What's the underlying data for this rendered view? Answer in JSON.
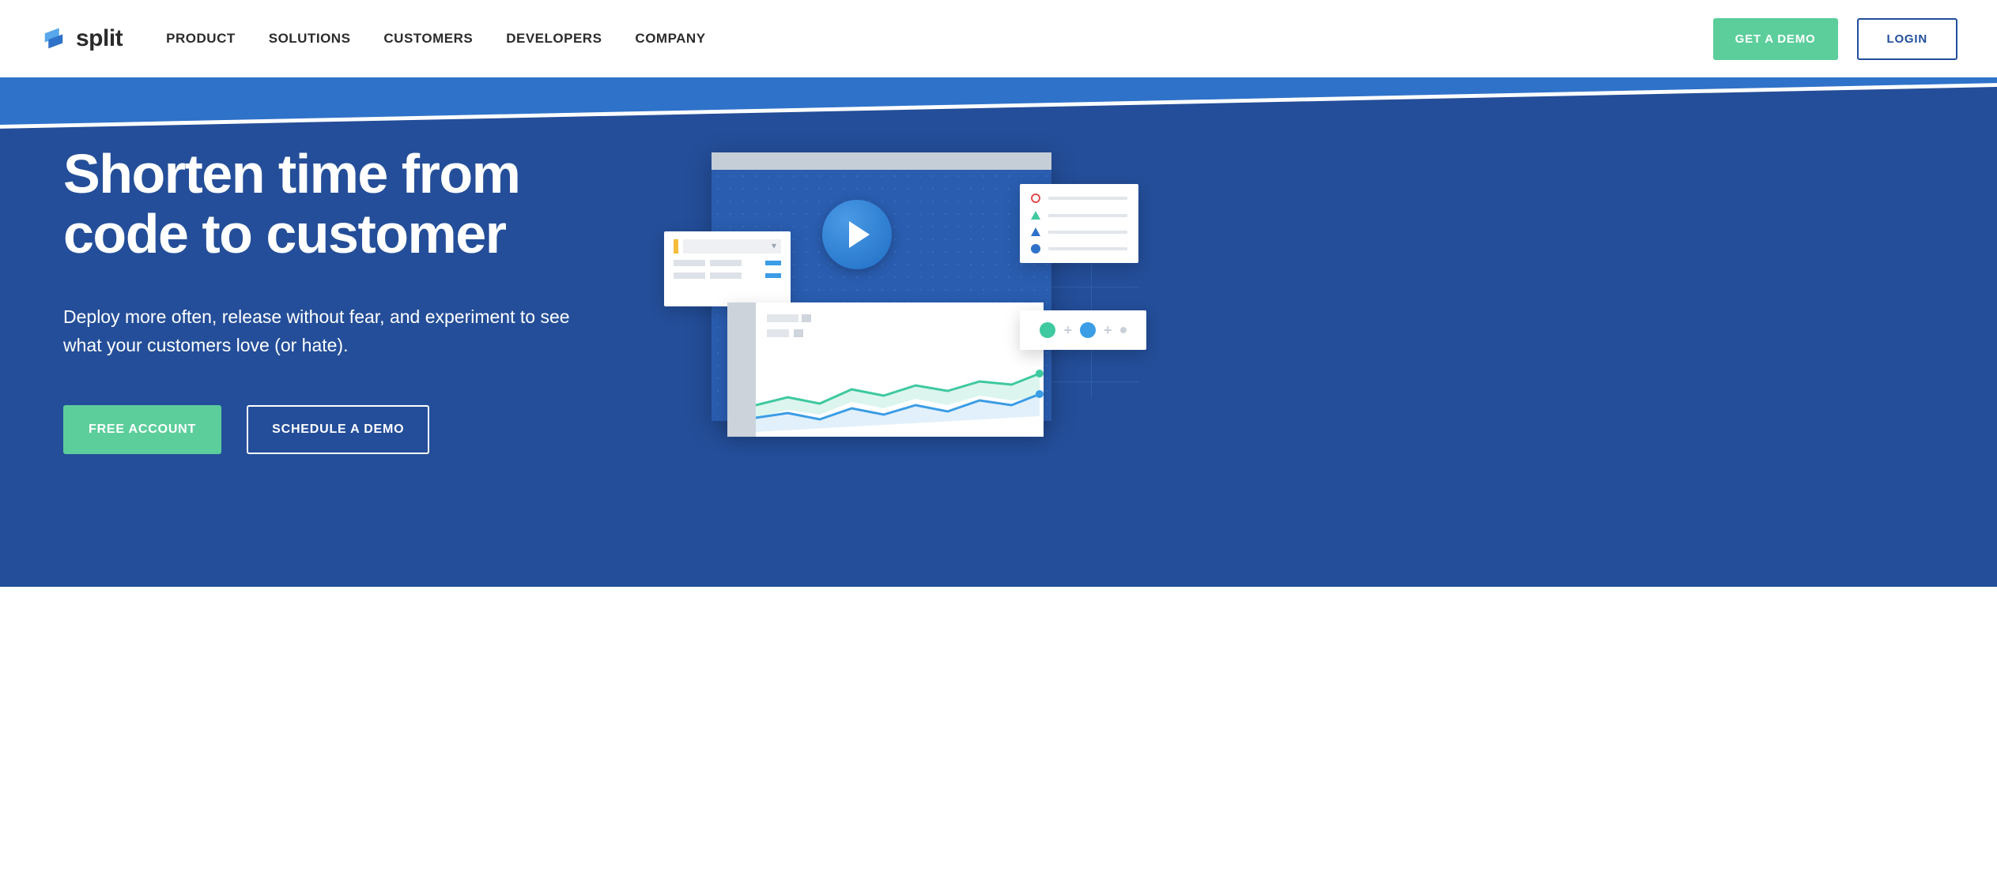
{
  "brand": {
    "name": "split"
  },
  "nav": {
    "items": [
      "PRODUCT",
      "SOLUTIONS",
      "CUSTOMERS",
      "DEVELOPERS",
      "COMPANY"
    ]
  },
  "header_actions": {
    "demo_label": "GET A DEMO",
    "login_label": "LOGIN"
  },
  "hero": {
    "title": "Shorten time from code to customer",
    "subtitle": "Deploy more often, release without fear, and experiment to see what your customers love (or hate).",
    "cta_primary": "FREE ACCOUNT",
    "cta_secondary": "SCHEDULE A DEMO"
  },
  "colors": {
    "brand_blue": "#244e99",
    "brand_blue_accent": "#2f72c9",
    "action_green": "#5cce9b",
    "login_border": "#224e9c",
    "nav_text": "#2b2b2b"
  },
  "icons": {
    "logo": "split-logo",
    "play": "play-icon"
  }
}
